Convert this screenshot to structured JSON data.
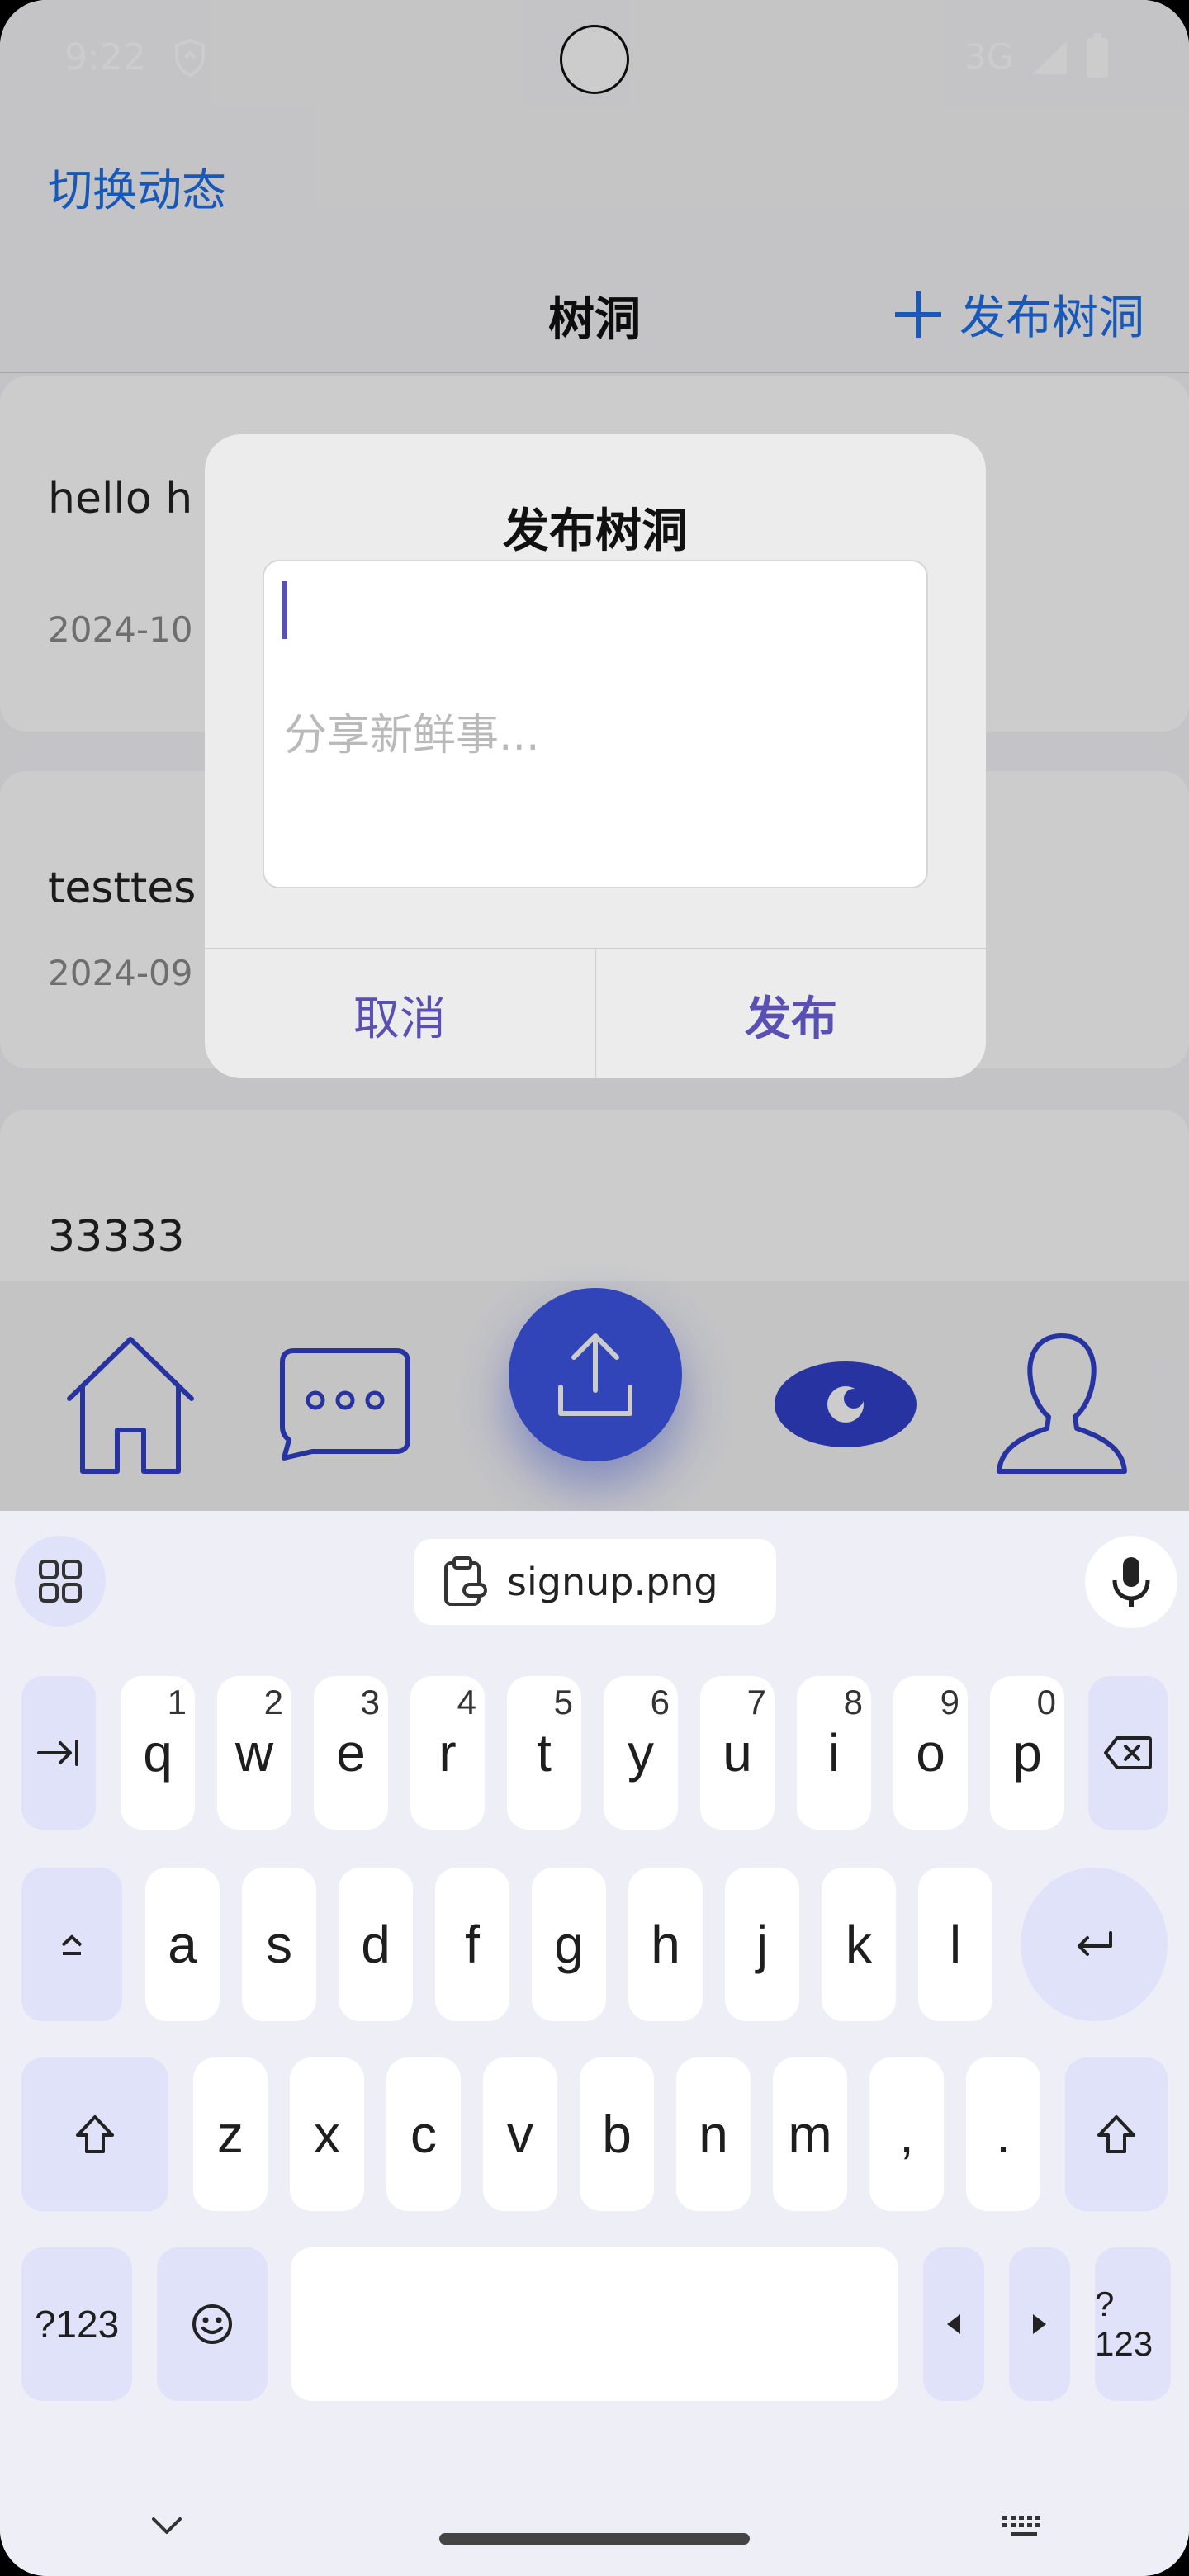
{
  "status_bar": {
    "time": "9:22",
    "network": "3G"
  },
  "app": {
    "switch_label": "切换动态",
    "title": "树洞",
    "publish_label": "发布树洞",
    "posts": [
      {
        "text": "hello h",
        "date": "2024-10"
      },
      {
        "text": "testtes",
        "date": "2024-09"
      },
      {
        "text": "33333",
        "date": ""
      }
    ],
    "nav": [
      "home-icon",
      "message-icon",
      "upload-icon",
      "eye-icon",
      "profile-icon"
    ],
    "accent_color": "#3f57e6"
  },
  "dialog": {
    "title": "发布树洞",
    "textarea_value": "",
    "placeholder": "分享新鲜事...",
    "cancel_label": "取消",
    "confirm_label": "发布"
  },
  "keyboard": {
    "clipboard_chip": "signup.png",
    "row1": [
      {
        "k": "q",
        "hint": "1"
      },
      {
        "k": "w",
        "hint": "2"
      },
      {
        "k": "e",
        "hint": "3"
      },
      {
        "k": "r",
        "hint": "4"
      },
      {
        "k": "t",
        "hint": "5"
      },
      {
        "k": "y",
        "hint": "6"
      },
      {
        "k": "u",
        "hint": "7"
      },
      {
        "k": "i",
        "hint": "8"
      },
      {
        "k": "o",
        "hint": "9"
      },
      {
        "k": "p",
        "hint": "0"
      }
    ],
    "row2": [
      "a",
      "s",
      "d",
      "f",
      "g",
      "h",
      "j",
      "k",
      "l"
    ],
    "row3": [
      "z",
      "x",
      "c",
      "v",
      "b",
      "n",
      "m",
      ",",
      "."
    ],
    "symbols_label": "?123",
    "symbols_label_right": "?123"
  }
}
